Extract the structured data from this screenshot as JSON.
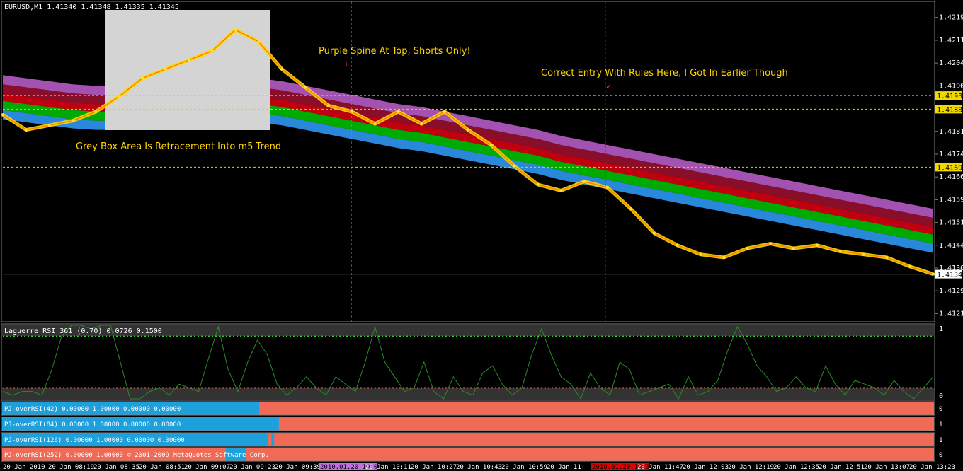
{
  "window": {
    "symbol_header": "EURUSD,M1  1.41340 1.41348 1.41335 1.41345"
  },
  "annotations": {
    "top_note": "Purple Spine At Top, Shorts Only!",
    "entry_note": "Correct Entry With Rules Here, I Got In Earlier Though",
    "box_note": "Grey Box Area Is Retracement Into m5 Trend"
  },
  "price_axis": {
    "ticks": [
      "1.42190",
      "1.42115",
      "1.42040",
      "1.41965",
      "1.41815",
      "1.41740",
      "1.41665",
      "1.41590",
      "1.41515",
      "1.41440",
      "1.41365",
      "1.41290",
      "1.41215"
    ],
    "levels": [
      {
        "label": "1.41933",
        "value": 1.41933
      },
      {
        "label": "1.41888",
        "value": 1.41888
      },
      {
        "label": "1.41697",
        "value": 1.41697
      }
    ],
    "current": {
      "label": "1.41345",
      "value": 1.41345
    },
    "min": 1.41195,
    "max": 1.42215
  },
  "time_axis": {
    "labels": [
      "20 Jan 2010",
      "20 Jan 08:19",
      "20 Jan 08:35",
      "20 Jan 08:51",
      "20 Jan 09:07",
      "20 Jan 09:23",
      "20 Jan 09:39",
      "2010.01.20 10:06",
      "20 Jan 10:11",
      "20 Jan 10:27",
      "20 Jan 10:43",
      "20 Jan 10:59",
      "20 Jan 11:",
      "2010.01.20 11:36",
      "20 Jan 11:47",
      "20 Jan 12:03",
      "20 Jan 12:19",
      "20 Jan 12:35",
      "20 Jan 12:51",
      "20 Jan 13:07",
      "20 Jan 13:23"
    ],
    "markers": [
      {
        "label": "2010.01.20 10:06",
        "color": "#c070e0"
      },
      {
        "label": "2010.01.20 11:36",
        "color": "#e00000"
      }
    ]
  },
  "rsi_panel": {
    "title": "Laguerre RSI 361 (0.70) 0.0726 0.1500",
    "scale_top": "1",
    "scale_bottom": "0"
  },
  "bar_panels": [
    {
      "title": "PJ-overRSI(42) 0.00000 1.00000 0.00000 0.00000",
      "side": "0"
    },
    {
      "title": "PJ-overRSI(84) 0.00000 1.00000 0.00000 0.00000",
      "side": "1"
    },
    {
      "title": "PJ-overRSI(126) 0.00000 1.00000 0.00000 0.00000",
      "side": "1"
    },
    {
      "title": "PJ-overRSI(252) 0.00000 1.00000 © 2001-2009 MetaQuotes Software Corp.",
      "side": "0"
    }
  ],
  "colors": {
    "bear_bar": "#f06a55",
    "bull_bar": "#1ea0dc",
    "price_line": "#ffd800",
    "ribbon_top": "#c060d0",
    "ribbon_red": "#e00010",
    "ribbon_green": "#00c800",
    "ribbon_blue": "#30a0ff",
    "level_line": "#e8d000",
    "rsi_line": "#2a8a2a"
  },
  "chart_data": {
    "type": "line",
    "title": "EURUSD,M1",
    "xlabel": "",
    "ylabel": "",
    "ylim": [
      1.41195,
      1.42215
    ],
    "x": [
      "08:03",
      "08:11",
      "08:19",
      "08:27",
      "08:35",
      "08:43",
      "08:51",
      "08:59",
      "09:07",
      "09:15",
      "09:23",
      "09:31",
      "09:39",
      "09:47",
      "09:55",
      "10:03",
      "10:11",
      "10:19",
      "10:27",
      "10:35",
      "10:43",
      "10:51",
      "10:59",
      "11:07",
      "11:15",
      "11:23",
      "11:31",
      "11:39",
      "11:47",
      "11:55",
      "12:03",
      "12:11",
      "12:19",
      "12:27",
      "12:35",
      "12:43",
      "12:51",
      "12:59",
      "13:07",
      "13:15",
      "13:23"
    ],
    "series": [
      {
        "values": [
          1.4187,
          1.4182,
          1.41835,
          1.4185,
          1.4188,
          1.4193,
          1.4199,
          1.4202,
          1.4205,
          1.4208,
          1.4215,
          1.4211,
          1.4202,
          1.4196,
          1.419,
          1.4188,
          1.4184,
          1.4188,
          1.4184,
          1.4188,
          1.4182,
          1.4177,
          1.417,
          1.4164,
          1.4162,
          1.4165,
          1.4163,
          1.4156,
          1.4148,
          1.4144,
          1.4141,
          1.414,
          1.4143,
          1.41445,
          1.4143,
          1.4144,
          1.4142,
          1.4141,
          1.414,
          1.4137,
          1.41345
        ]
      },
      {
        "values": [
          1.42,
          1.4199,
          1.4198,
          1.4197,
          1.41965,
          1.41965,
          1.4197,
          1.41975,
          1.41985,
          1.41995,
          1.42,
          1.4199,
          1.4198,
          1.41965,
          1.4195,
          1.41935,
          1.4192,
          1.41905,
          1.41895,
          1.4188,
          1.41865,
          1.4185,
          1.41835,
          1.4182,
          1.418,
          1.41785,
          1.4177,
          1.41755,
          1.4174,
          1.41725,
          1.4171,
          1.41695,
          1.4168,
          1.41665,
          1.4165,
          1.41635,
          1.4162,
          1.41605,
          1.4159,
          1.41575,
          1.4156
        ]
      }
    ],
    "levels": [
      1.41933,
      1.41888,
      1.41697
    ],
    "current_price": 1.41345,
    "grid": false,
    "legend": "none"
  },
  "rsi_data": {
    "ylim": [
      0,
      1
    ],
    "levels": [
      0.15,
      0.85
    ],
    "values": [
      0.1,
      0.05,
      0.1,
      0.1,
      0.05,
      0.4,
      0.85,
      1,
      1,
      0.95,
      1,
      1,
      0.5,
      0.0,
      0.0,
      0.1,
      0.15,
      0.05,
      0.2,
      0.15,
      0.1,
      0.55,
      0.98,
      0.4,
      0.1,
      0.5,
      0.8,
      0.6,
      0.2,
      0.05,
      0.15,
      0.3,
      0.15,
      0.05,
      0.3,
      0.2,
      0.1,
      0.5,
      0.98,
      0.5,
      0.3,
      0.1,
      0.15,
      0.5,
      0.1,
      0.0,
      0.3,
      0.1,
      0.05,
      0.35,
      0.45,
      0.2,
      0.05,
      0.15,
      0.6,
      0.95,
      0.6,
      0.3,
      0.2,
      0.0,
      0.35,
      0.15,
      0.05,
      0.5,
      0.4,
      0.05,
      0.1,
      0.15,
      0.2,
      0.0,
      0.3,
      0.05,
      0.1,
      0.25,
      0.65,
      0.98,
      0.75,
      0.45,
      0.3,
      0.1,
      0.15,
      0.3,
      0.15,
      0.1,
      0.45,
      0.2,
      0.05,
      0.25,
      0.2,
      0.15,
      0.05,
      0.25,
      0.1,
      0.0,
      0.15,
      0.3
    ]
  },
  "bar_data": [
    {
      "bull_until": 0.276,
      "segments": []
    },
    {
      "bull_until": 0.297,
      "segments": []
    },
    {
      "bull_until": 0.285,
      "segments": [
        [
          0.289,
          0.292
        ]
      ]
    },
    {
      "bull_until": 0.0,
      "segments": [
        [
          0.24,
          0.262
        ]
      ]
    }
  ]
}
